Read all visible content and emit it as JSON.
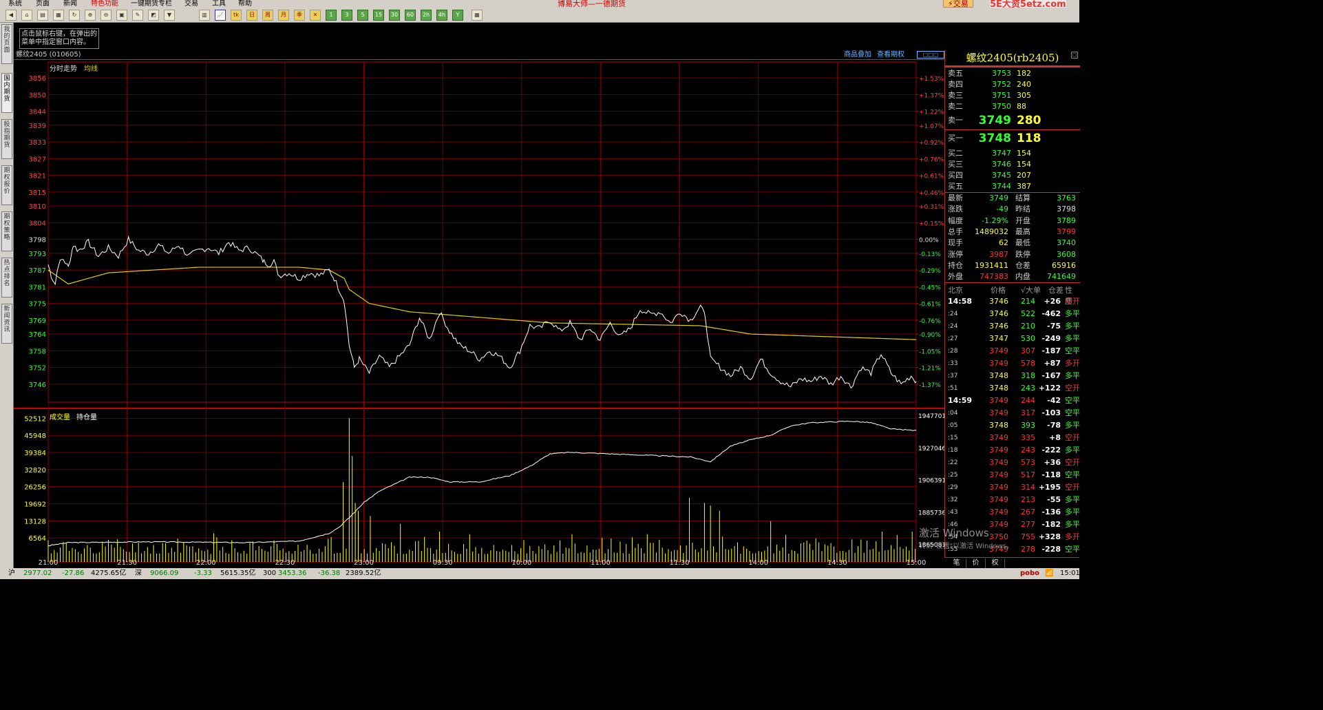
{
  "menu": {
    "items": [
      "系统",
      "页面",
      "新闻",
      "特色功能",
      "一键期货专栏",
      "交易",
      "工具",
      "帮助"
    ],
    "app_title": "博易大师—一德期货",
    "trade_button": "交易",
    "watermark": "5E大资5etz.com"
  },
  "tip_text": "点击鼠标右键，在弹出的菜单中指定窗口内容。",
  "left_tabs": [
    "我的页面",
    "国内期货",
    "股指期货",
    "期权报价",
    "期权策略",
    "热点排名",
    "新闻资讯"
  ],
  "chart": {
    "title": "螺纹2405 (010605)",
    "links": [
      "商品叠加",
      "查看期权"
    ],
    "label_trend": "分时走势",
    "label_avg": "均线",
    "label_volume": "成交量",
    "label_oi": "持仓量"
  },
  "chart_data": {
    "type": "line",
    "price_ticks": [
      "3856",
      "3850",
      "3844",
      "3839",
      "3833",
      "3827",
      "3821",
      "3815",
      "3810",
      "3804",
      "3798",
      "3793",
      "3787",
      "3781",
      "3775",
      "3769",
      "3764",
      "3758",
      "3752",
      "3746"
    ],
    "pct_ticks": [
      "+1.53%",
      "+1.37%",
      "+1.22%",
      "+1.07%",
      "+0.92%",
      "+0.76%",
      "+0.61%",
      "+0.46%",
      "+0.31%",
      "+0.15%",
      "0.00%",
      "-0.13%",
      "-0.29%",
      "-0.45%",
      "-0.61%",
      "-0.76%",
      "-0.90%",
      "-1.05%",
      "-1.21%",
      "-1.37%"
    ],
    "vol_ticks": [
      "52512",
      "45948",
      "39384",
      "32820",
      "26256",
      "19692",
      "13128",
      "6564"
    ],
    "oi_ticks": [
      "1947701",
      "1927046",
      "1906391",
      "1885736",
      "1865081"
    ],
    "time_ticks": [
      "21:00",
      "21:30",
      "22:00",
      "22:30",
      "23:00",
      "09:30",
      "10:00",
      "11:00",
      "11:30",
      "14:00",
      "14:30",
      "15:00"
    ],
    "price_anchors": [
      [
        0,
        3789
      ],
      [
        3,
        3785
      ],
      [
        7,
        3782
      ],
      [
        10,
        3789
      ],
      [
        15,
        3791
      ],
      [
        20,
        3788
      ],
      [
        25,
        3796
      ],
      [
        30,
        3794
      ],
      [
        40,
        3797
      ],
      [
        50,
        3792
      ],
      [
        60,
        3795
      ],
      [
        70,
        3792
      ],
      [
        80,
        3798
      ],
      [
        90,
        3794
      ],
      [
        100,
        3793
      ],
      [
        110,
        3796
      ],
      [
        120,
        3793
      ],
      [
        130,
        3796
      ],
      [
        140,
        3792
      ],
      [
        150,
        3794
      ],
      [
        160,
        3795
      ],
      [
        170,
        3793
      ],
      [
        180,
        3797
      ],
      [
        190,
        3794
      ],
      [
        200,
        3795
      ],
      [
        210,
        3792
      ],
      [
        215,
        3790
      ],
      [
        220,
        3789
      ],
      [
        225,
        3790
      ],
      [
        230,
        3785
      ],
      [
        240,
        3786
      ],
      [
        250,
        3784
      ],
      [
        260,
        3786
      ],
      [
        270,
        3785
      ],
      [
        280,
        3787
      ],
      [
        285,
        3784
      ],
      [
        290,
        3780
      ],
      [
        295,
        3776
      ],
      [
        300,
        3760
      ],
      [
        305,
        3752
      ],
      [
        310,
        3755
      ],
      [
        320,
        3750
      ],
      [
        330,
        3756
      ],
      [
        340,
        3752
      ],
      [
        350,
        3756
      ],
      [
        360,
        3760
      ],
      [
        370,
        3770
      ],
      [
        380,
        3762
      ],
      [
        390,
        3772
      ],
      [
        400,
        3765
      ],
      [
        410,
        3760
      ],
      [
        420,
        3758
      ],
      [
        430,
        3755
      ],
      [
        440,
        3758
      ],
      [
        450,
        3756
      ],
      [
        460,
        3752
      ],
      [
        470,
        3758
      ],
      [
        480,
        3767
      ],
      [
        490,
        3766
      ],
      [
        500,
        3769
      ],
      [
        510,
        3765
      ],
      [
        520,
        3768
      ],
      [
        530,
        3762
      ],
      [
        540,
        3766
      ],
      [
        550,
        3762
      ],
      [
        560,
        3768
      ],
      [
        570,
        3763
      ],
      [
        580,
        3766
      ],
      [
        590,
        3773
      ],
      [
        600,
        3771
      ],
      [
        610,
        3772
      ],
      [
        620,
        3768
      ],
      [
        630,
        3772
      ],
      [
        640,
        3769
      ],
      [
        650,
        3774
      ],
      [
        655,
        3770
      ],
      [
        660,
        3755
      ],
      [
        670,
        3752
      ],
      [
        680,
        3749
      ],
      [
        690,
        3752
      ],
      [
        700,
        3748
      ],
      [
        710,
        3755
      ],
      [
        720,
        3750
      ],
      [
        730,
        3747
      ],
      [
        740,
        3745
      ],
      [
        750,
        3748
      ],
      [
        760,
        3747
      ],
      [
        770,
        3749
      ],
      [
        780,
        3746
      ],
      [
        790,
        3749
      ],
      [
        800,
        3745
      ],
      [
        810,
        3752
      ],
      [
        820,
        3750
      ],
      [
        830,
        3757
      ],
      [
        840,
        3750
      ],
      [
        850,
        3746
      ],
      [
        860,
        3749
      ],
      [
        865,
        3747
      ]
    ],
    "avg_anchors": [
      [
        0,
        3787
      ],
      [
        20,
        3782
      ],
      [
        60,
        3786
      ],
      [
        150,
        3788
      ],
      [
        250,
        3788
      ],
      [
        280,
        3787
      ],
      [
        295,
        3784
      ],
      [
        300,
        3780
      ],
      [
        320,
        3775
      ],
      [
        360,
        3772
      ],
      [
        500,
        3768
      ],
      [
        650,
        3767
      ],
      [
        700,
        3764
      ],
      [
        865,
        3762
      ]
    ],
    "oi_anchors": [
      [
        0,
        1864000
      ],
      [
        20,
        1866000
      ],
      [
        100,
        1866500
      ],
      [
        200,
        1866000
      ],
      [
        250,
        1867000
      ],
      [
        280,
        1872000
      ],
      [
        290,
        1876000
      ],
      [
        300,
        1882000
      ],
      [
        315,
        1892000
      ],
      [
        330,
        1899000
      ],
      [
        360,
        1908000
      ],
      [
        380,
        1908000
      ],
      [
        400,
        1905000
      ],
      [
        430,
        1905000
      ],
      [
        460,
        1909000
      ],
      [
        480,
        1915000
      ],
      [
        500,
        1923000
      ],
      [
        520,
        1924000
      ],
      [
        560,
        1923000
      ],
      [
        600,
        1922000
      ],
      [
        640,
        1921000
      ],
      [
        660,
        1918000
      ],
      [
        680,
        1928000
      ],
      [
        700,
        1932000
      ],
      [
        720,
        1935000
      ],
      [
        740,
        1941000
      ],
      [
        760,
        1943000
      ],
      [
        800,
        1944000
      ],
      [
        820,
        1943000
      ],
      [
        840,
        1939000
      ],
      [
        865,
        1938000
      ]
    ],
    "volume_spikes": [
      [
        295,
        28000
      ],
      [
        300,
        52512
      ],
      [
        302,
        38000
      ],
      [
        304,
        24000
      ],
      [
        306,
        20000
      ],
      [
        310,
        17000
      ],
      [
        320,
        15000
      ],
      [
        350,
        12000
      ],
      [
        420,
        8000
      ],
      [
        640,
        22000
      ],
      [
        655,
        20000
      ],
      [
        660,
        19000
      ],
      [
        670,
        17000
      ],
      [
        720,
        13000
      ],
      [
        800,
        6000
      ],
      [
        830,
        9000
      ],
      [
        860,
        9000
      ]
    ],
    "ylim_price": [
      3743,
      3858
    ],
    "ylim_vol": [
      0,
      55000
    ],
    "ylim_oi": [
      1858000,
      1950000
    ]
  },
  "panel": {
    "title": "螺纹2405(rb2405)",
    "asks": [
      {
        "label": "卖五",
        "price": "3753",
        "vol": "182"
      },
      {
        "label": "卖四",
        "price": "3752",
        "vol": "240"
      },
      {
        "label": "卖三",
        "price": "3751",
        "vol": "305"
      },
      {
        "label": "卖二",
        "price": "3750",
        "vol": "88"
      },
      {
        "label": "卖一",
        "price": "3749",
        "vol": "280"
      }
    ],
    "bids": [
      {
        "label": "买一",
        "price": "3748",
        "vol": "118"
      },
      {
        "label": "买二",
        "price": "3747",
        "vol": "154"
      },
      {
        "label": "买三",
        "price": "3746",
        "vol": "154"
      },
      {
        "label": "买四",
        "price": "3745",
        "vol": "207"
      },
      {
        "label": "买五",
        "price": "3744",
        "vol": "387"
      }
    ],
    "stats_left": [
      {
        "label": "最新",
        "value": "3749",
        "color": "#3f3"
      },
      {
        "label": "涨跌",
        "value": "-49",
        "color": "#3f3"
      },
      {
        "label": "幅度",
        "value": "-1.29%",
        "color": "#3f3"
      },
      {
        "label": "总手",
        "value": "1489032",
        "color": "#ff3"
      },
      {
        "label": "现手",
        "value": "62",
        "color": "#ff3"
      },
      {
        "label": "涨停",
        "value": "3987",
        "color": "#f33"
      },
      {
        "label": "持仓",
        "value": "1931411",
        "color": "#ff3"
      },
      {
        "label": "外盘",
        "value": "747383",
        "color": "#f33"
      }
    ],
    "stats_right": [
      {
        "label": "结算",
        "value": "3763",
        "color": "#3f3"
      },
      {
        "label": "昨结",
        "value": "3798",
        "color": "#ddd"
      },
      {
        "label": "开盘",
        "value": "3789",
        "color": "#3f3"
      },
      {
        "label": "最高",
        "value": "3799",
        "color": "#f33"
      },
      {
        "label": "最低",
        "value": "3740",
        "color": "#3f3"
      },
      {
        "label": "跌停",
        "value": "3608",
        "color": "#3f3"
      },
      {
        "label": "仓差",
        "value": "65916",
        "color": "#ff3"
      },
      {
        "label": "内盘",
        "value": "741649",
        "color": "#3f3"
      }
    ],
    "tick_header": [
      "北京",
      "价格",
      "√大单",
      "仓差",
      "性质"
    ],
    "ticks": [
      {
        "t": "14:58",
        "p": "3746",
        "v": "214",
        "d": "+26",
        "n": "空开",
        "big": true
      },
      {
        "t": ":24",
        "p": "3746",
        "v": "522",
        "d": "-462",
        "n": "多平"
      },
      {
        "t": ":24",
        "p": "3746",
        "v": "210",
        "d": "-75",
        "n": "多平"
      },
      {
        "t": ":27",
        "p": "3747",
        "v": "530",
        "d": "-249",
        "n": "多平"
      },
      {
        "t": ":28",
        "p": "3749",
        "v": "307",
        "d": "-187",
        "n": "空平"
      },
      {
        "t": ":33",
        "p": "3749",
        "v": "578",
        "d": "+87",
        "n": "多开"
      },
      {
        "t": ":37",
        "p": "3748",
        "v": "318",
        "d": "-167",
        "n": "多平"
      },
      {
        "t": ":51",
        "p": "3748",
        "v": "243",
        "d": "+122",
        "n": "空开"
      },
      {
        "t": "14:59",
        "p": "3749",
        "v": "244",
        "d": "-42",
        "n": "空平",
        "big": true
      },
      {
        "t": ":04",
        "p": "3749",
        "v": "317",
        "d": "-103",
        "n": "空平"
      },
      {
        "t": ":05",
        "p": "3748",
        "v": "393",
        "d": "-78",
        "n": "多平"
      },
      {
        "t": ":15",
        "p": "3749",
        "v": "335",
        "d": "+8",
        "n": "空开"
      },
      {
        "t": ":18",
        "p": "3749",
        "v": "243",
        "d": "-222",
        "n": "多平"
      },
      {
        "t": ":22",
        "p": "3749",
        "v": "573",
        "d": "+36",
        "n": "空开"
      },
      {
        "t": ":25",
        "p": "3749",
        "v": "517",
        "d": "-118",
        "n": "空平"
      },
      {
        "t": ":29",
        "p": "3749",
        "v": "314",
        "d": "+195",
        "n": "空开"
      },
      {
        "t": ":32",
        "p": "3749",
        "v": "213",
        "d": "-55",
        "n": "多平"
      },
      {
        "t": ":43",
        "p": "3749",
        "v": "267",
        "d": "-136",
        "n": "多平"
      },
      {
        "t": ":46",
        "p": "3749",
        "v": "277",
        "d": "-182",
        "n": "多平"
      },
      {
        "t": ":54",
        "p": "3750",
        "v": "755",
        "d": "+328",
        "n": "多开"
      },
      {
        "t": ":55",
        "p": "3749",
        "v": "278",
        "d": "-228",
        "n": "空平"
      }
    ],
    "bottom_tabs": [
      "笔",
      "价",
      "权"
    ],
    "activation_line1": "激活 Windows",
    "activation_line2": "转到\"设置\"以激活 Windows。"
  },
  "status": {
    "sh_label": "沪",
    "sh_price": "2977.02",
    "sh_chg": "-27.86",
    "sh_amt": "4275.65亿",
    "sz_label": "深",
    "sz_price": "9066.09",
    "sz_chg": "-3.33",
    "sz_amt": "5615.35亿",
    "hs_label": "300",
    "hs_price": "3453.36",
    "hs_chg": "-36.38",
    "hs_amt": "2389.52亿",
    "brand": "pobo",
    "time": "15:01"
  },
  "colors": {
    "up": "#ff3333",
    "down": "#33ff33",
    "grid": "#8b0000",
    "price_line": "#ffffff",
    "avg_line": "#e0d000",
    "volume": "#ffff00"
  }
}
